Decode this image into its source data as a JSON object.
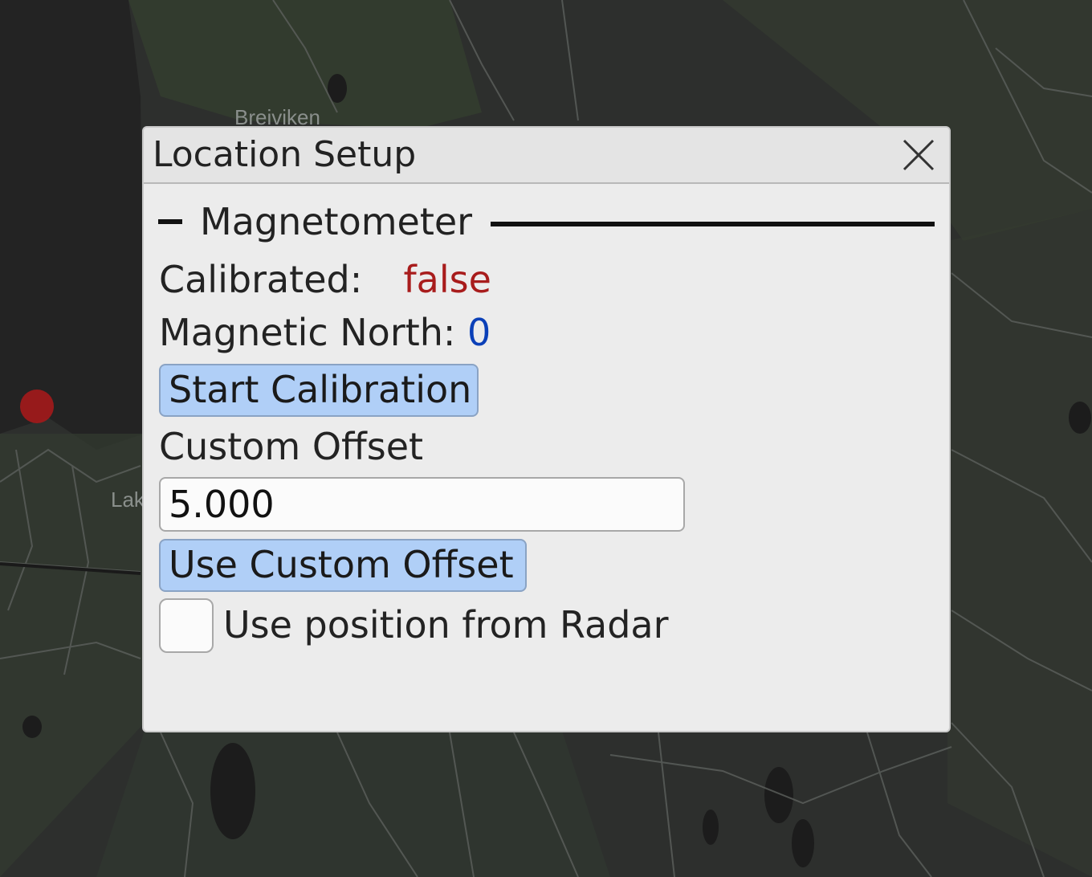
{
  "map": {
    "labels": {
      "breiviken": "Breiviken",
      "partial_lak": "Lak"
    }
  },
  "dialog": {
    "title": "Location Setup",
    "close_icon": "close-icon",
    "section": {
      "title": "Magnetometer",
      "collapse_icon": "minus-icon"
    },
    "calibrated": {
      "label": "Calibrated:",
      "value": "false",
      "value_color": "#a81c1c"
    },
    "magnetic_north": {
      "label": "Magnetic North:",
      "value": "0",
      "value_color": "#0b40b8"
    },
    "start_calibration_label": "Start Calibration",
    "custom_offset": {
      "label": "Custom Offset",
      "value": "5.000"
    },
    "use_custom_offset_label": "Use Custom Offset",
    "use_radar_position": {
      "label": "Use position from Radar",
      "checked": false
    }
  },
  "colors": {
    "button_bg": "#b0cff7",
    "dialog_bg": "#ececec",
    "map_bg": "#2d2f2d",
    "marker": "#a4191b"
  }
}
